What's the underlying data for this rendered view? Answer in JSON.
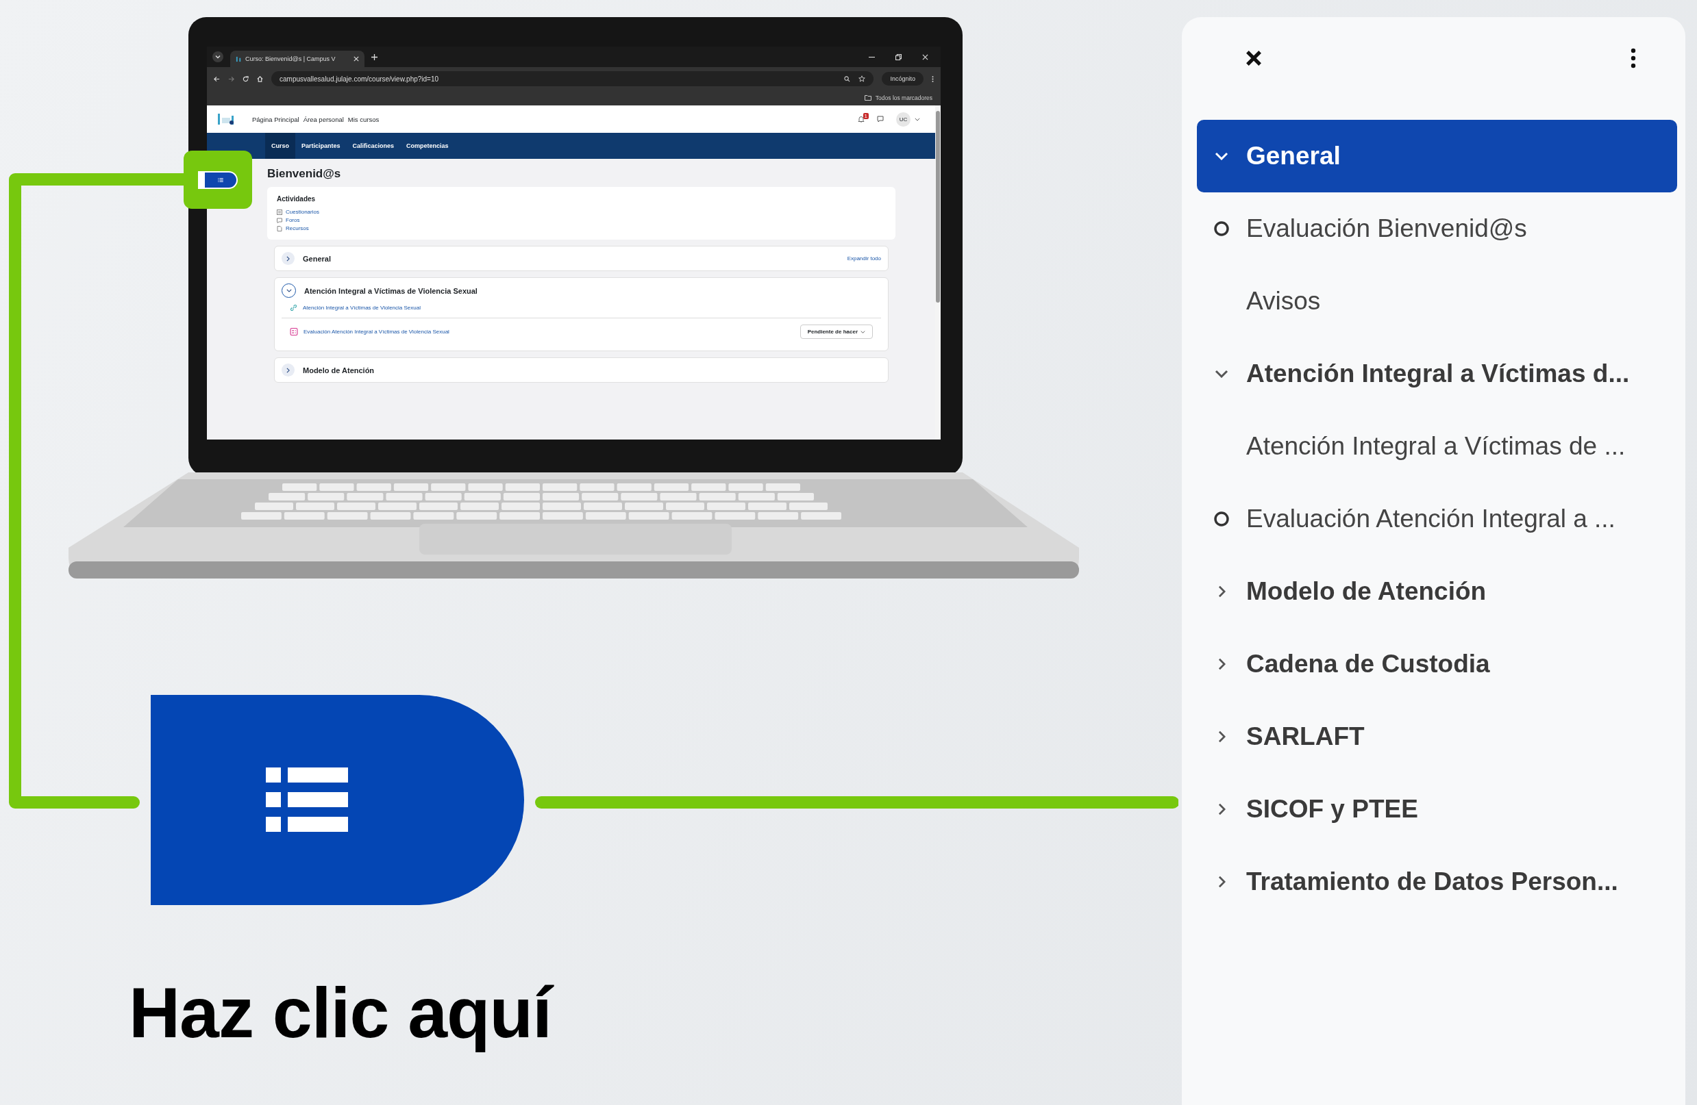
{
  "browser": {
    "tab_title": "Curso: Bienvenid@s | Campus V",
    "url": "campusvallesalud.julaje.com/course/view.php?id=10",
    "incognito_label": "Incógnito",
    "bookmarks_label": "Todos los marcadores"
  },
  "site": {
    "nav_links": [
      "Página Principal",
      "Área personal",
      "Mis cursos"
    ],
    "notification_count": "1",
    "user_initials": "UC",
    "course_tabs": [
      {
        "label": "Curso",
        "selected": true
      },
      {
        "label": "Participantes",
        "selected": false
      },
      {
        "label": "Calificaciones",
        "selected": false
      },
      {
        "label": "Competencias",
        "selected": false
      }
    ],
    "page_title": "Bienvenid@s",
    "activities": {
      "title": "Actividades",
      "links": [
        {
          "kind": "quiz",
          "label": "Cuestionarios"
        },
        {
          "kind": "forum",
          "label": "Foros"
        },
        {
          "kind": "resource",
          "label": "Recursos"
        }
      ]
    },
    "expand_all": "Expandir todo",
    "sections": [
      {
        "title": "General",
        "expanded": false
      },
      {
        "title": "Atención Integral a Víctimas de Violencia Sexual",
        "expanded": true,
        "items": [
          {
            "kind": "url",
            "label": "Atención Integral a Víctimas de Violencia Sexual"
          },
          {
            "kind": "quiz",
            "label": "Evaluación Atención Integral a Víctimas de Violencia Sexual",
            "status": "Pendiente de hacer"
          }
        ]
      },
      {
        "title": "Modelo de Atención",
        "expanded": false
      }
    ]
  },
  "callout": {
    "label": "Haz clic aquí"
  },
  "course_index": {
    "items": [
      {
        "kind": "section",
        "label": "General",
        "expanded": true,
        "selected": true
      },
      {
        "kind": "activity",
        "label": "Evaluación Bienvenid@s",
        "completion_circle": true,
        "selected": false
      },
      {
        "kind": "activity",
        "label": "Avisos",
        "completion_circle": false,
        "selected": false
      },
      {
        "kind": "section",
        "label": "Atención Integral a Víctimas d...",
        "expanded": true,
        "selected": false
      },
      {
        "kind": "activity",
        "label": "Atención Integral a Víctimas de ...",
        "completion_circle": false,
        "selected": false
      },
      {
        "kind": "activity",
        "label": "Evaluación Atención Integral a ...",
        "completion_circle": true,
        "selected": false
      },
      {
        "kind": "section",
        "label": "Modelo de Atención",
        "expanded": false,
        "selected": false
      },
      {
        "kind": "section",
        "label": "Cadena de Custodia",
        "expanded": false,
        "selected": false
      },
      {
        "kind": "section",
        "label": "SARLAFT",
        "expanded": false,
        "selected": false
      },
      {
        "kind": "section",
        "label": "SICOF y PTEE",
        "expanded": false,
        "selected": false
      },
      {
        "kind": "section",
        "label": "Tratamiento de Datos Person...",
        "expanded": false,
        "selected": false
      }
    ]
  }
}
